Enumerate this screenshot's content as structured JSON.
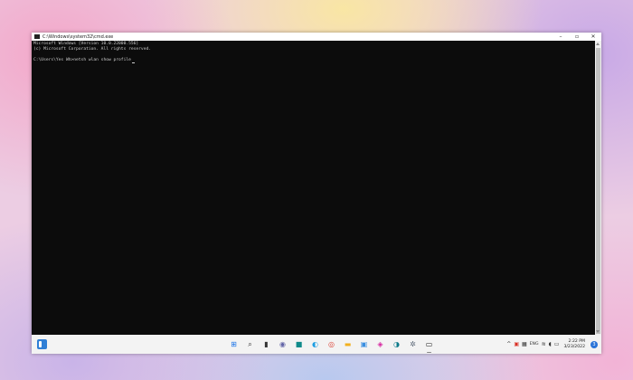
{
  "window": {
    "title": "C:\\Windows\\system32\\cmd.exe",
    "controls": {
      "minimize": "–",
      "maximize": "▫",
      "close": "✕"
    }
  },
  "console": {
    "lines": [
      "Microsoft Windows [Version 10.0.22000.556]",
      "(c) Microsoft Corporation. All rights reserved.",
      "",
      "C:\\Users\\Yes Wh>netsh wlan show profile"
    ]
  },
  "taskbar": {
    "icons": [
      {
        "name": "start-icon",
        "glyph": "⊞",
        "color": "#1a73e8"
      },
      {
        "name": "search-icon",
        "glyph": "⌕",
        "color": "#333333"
      },
      {
        "name": "task-view-icon",
        "glyph": "▮",
        "color": "#333333"
      },
      {
        "name": "chat-icon",
        "glyph": "◉",
        "color": "#6264a7"
      },
      {
        "name": "app-teal-icon",
        "glyph": "■",
        "color": "#0f8a8a"
      },
      {
        "name": "edge-icon",
        "glyph": "◐",
        "color": "#1b9de2"
      },
      {
        "name": "chrome-icon",
        "glyph": "◎",
        "color": "#db4437"
      },
      {
        "name": "file-explorer-icon",
        "glyph": "▬",
        "color": "#f2b01e"
      },
      {
        "name": "photos-icon",
        "glyph": "▣",
        "color": "#3b8fe0"
      },
      {
        "name": "instagram-icon",
        "glyph": "◈",
        "color": "#d6249f"
      },
      {
        "name": "edge-beta-icon",
        "glyph": "◑",
        "color": "#0c7a8a"
      },
      {
        "name": "settings-icon",
        "glyph": "✲",
        "color": "#5f6b7a"
      },
      {
        "name": "terminal-icon",
        "glyph": "▭",
        "color": "#1e1e1e"
      }
    ],
    "tray": {
      "chevron": "^",
      "lang": "ENG",
      "wifi": "≋",
      "speaker": "◖",
      "battery": "▭",
      "time": "2:22 PM",
      "date": "3/23/2022",
      "notifications": "3"
    }
  }
}
